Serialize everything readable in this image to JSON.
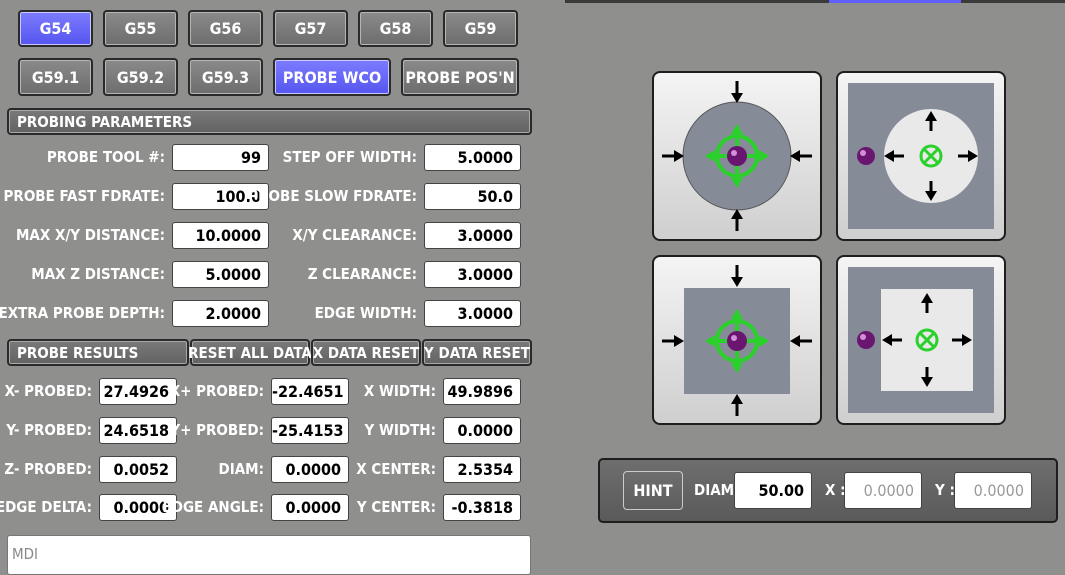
{
  "wco_buttons": [
    {
      "label": "G54",
      "active": true
    },
    {
      "label": "G55",
      "active": false
    },
    {
      "label": "G56",
      "active": false
    },
    {
      "label": "G57",
      "active": false
    },
    {
      "label": "G58",
      "active": false
    },
    {
      "label": "G59",
      "active": false
    },
    {
      "label": "G59.1",
      "active": false
    },
    {
      "label": "G59.2",
      "active": false
    },
    {
      "label": "G59.3",
      "active": false
    },
    {
      "label": "PROBE WCO",
      "active": true
    },
    {
      "label": "PROBE POS'N",
      "active": false
    }
  ],
  "parameters": {
    "header": "PROBING PARAMETERS",
    "probe_tool": {
      "label": "PROBE TOOL #:",
      "value": "99"
    },
    "step_off_width": {
      "label": "STEP OFF WIDTH:",
      "value": "5.0000"
    },
    "probe_fast_fdrate": {
      "label": "PROBE FAST FDRATE:",
      "value": "100.0"
    },
    "probe_slow_fdrate": {
      "label": "PROBE SLOW FDRATE:",
      "value": "50.0"
    },
    "max_xy_distance": {
      "label": "MAX X/Y DISTANCE:",
      "value": "10.0000"
    },
    "xy_clearance": {
      "label": "X/Y CLEARANCE:",
      "value": "3.0000"
    },
    "max_z_distance": {
      "label": "MAX Z DISTANCE:",
      "value": "5.0000"
    },
    "z_clearance": {
      "label": "Z CLEARANCE:",
      "value": "3.0000"
    },
    "extra_probe_depth": {
      "label": "EXTRA PROBE DEPTH:",
      "value": "2.0000"
    },
    "edge_width": {
      "label": "EDGE WIDTH:",
      "value": "3.0000"
    }
  },
  "results": {
    "header": "PROBE RESULTS",
    "reset_all": "RESET ALL DATA",
    "x_reset": "X DATA RESET",
    "y_reset": "Y DATA RESET",
    "x_minus": {
      "label": "X- PROBED:",
      "value": "27.4926"
    },
    "x_plus": {
      "label": "X+ PROBED:",
      "value": "-22.4651"
    },
    "x_width": {
      "label": "X WIDTH:",
      "value": "49.9896"
    },
    "y_minus": {
      "label": "Y- PROBED:",
      "value": "24.6518"
    },
    "y_plus": {
      "label": "Y+ PROBED:",
      "value": "-25.4153"
    },
    "y_width": {
      "label": "Y WIDTH:",
      "value": "0.0000"
    },
    "z_minus": {
      "label": "Z- PROBED:",
      "value": "0.0052"
    },
    "diam": {
      "label": "DIAM:",
      "value": "0.0000"
    },
    "x_center": {
      "label": "X CENTER:",
      "value": "2.5354"
    },
    "edge_delta": {
      "label": "EDGE DELTA:",
      "value": "0.0000"
    },
    "edge_angle": {
      "label": "EDGE ANGLE:",
      "value": "0.0000"
    },
    "y_center": {
      "label": "Y CENTER:",
      "value": "-0.3818"
    }
  },
  "mdi": {
    "placeholder": "MDI"
  },
  "hint_bar": {
    "hint_label": "HINT",
    "diam_label": "DIAM:",
    "diam_value": "50.00",
    "x_label": "X :",
    "x_value": "0.0000",
    "y_label": "Y :",
    "y_value": "0.0000"
  },
  "probe_icons": [
    "inside-circle-probe",
    "outside-circle-probe",
    "inside-rect-probe",
    "outside-rect-probe"
  ],
  "colors": {
    "active": "#5c5cf4",
    "green": "#2bd12b",
    "probe": "#7a1a7a",
    "panel": "#8f908e"
  }
}
